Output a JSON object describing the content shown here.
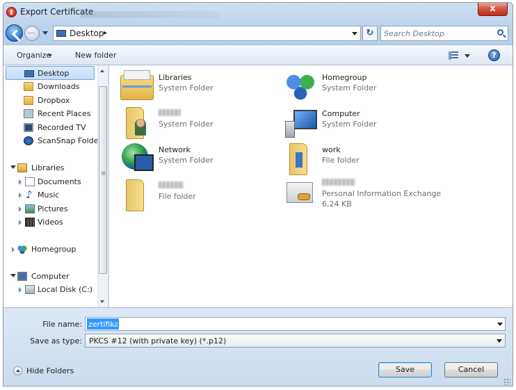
{
  "window": {
    "title": "Export Certificate",
    "close_label": "x"
  },
  "nav": {
    "address": {
      "location": "Desktop",
      "separator": "▸"
    },
    "refresh_label": "↻",
    "search": {
      "placeholder": "Search Desktop"
    }
  },
  "toolbar": {
    "organize_label": "Organize",
    "new_folder_label": "New folder",
    "help_label": "?"
  },
  "sidebar": {
    "favorites": [
      {
        "label": "Desktop",
        "icon": "desktop-icon",
        "selected": true
      },
      {
        "label": "Downloads",
        "icon": "folder-icon"
      },
      {
        "label": "Dropbox",
        "icon": "dropbox-icon"
      },
      {
        "label": "Recent Places",
        "icon": "recent-places-icon"
      },
      {
        "label": "Recorded TV",
        "icon": "tv-icon"
      },
      {
        "label": "ScanSnap Folder",
        "icon": "scansnap-icon"
      }
    ],
    "libraries": {
      "label": "Libraries",
      "items": [
        {
          "label": "Documents",
          "icon": "documents-icon"
        },
        {
          "label": "Music",
          "icon": "music-icon"
        },
        {
          "label": "Pictures",
          "icon": "pictures-icon"
        },
        {
          "label": "Videos",
          "icon": "videos-icon"
        }
      ]
    },
    "homegroup": {
      "label": "Homegroup"
    },
    "computer": {
      "label": "Computer",
      "items": [
        {
          "label": "Local Disk (C:)",
          "icon": "disk-icon"
        }
      ]
    }
  },
  "items": [
    {
      "name": "Libraries",
      "subtitle": "System Folder",
      "icon": "libraries-icon"
    },
    {
      "name": "Homegroup",
      "subtitle": "System Folder",
      "icon": "homegroup-icon"
    },
    {
      "name": "",
      "subtitle": "System Folder",
      "icon": "user-folder-icon",
      "name_redacted": true
    },
    {
      "name": "Computer",
      "subtitle": "System Folder",
      "icon": "computer-icon"
    },
    {
      "name": "Network",
      "subtitle": "System Folder",
      "icon": "network-icon"
    },
    {
      "name": "work",
      "subtitle": "File folder",
      "icon": "folder-icon"
    },
    {
      "name": "",
      "subtitle": "File folder",
      "icon": "folder-icon",
      "name_redacted": true
    },
    {
      "name": "",
      "subtitle": "Personal Information Exchange",
      "size": "6,24 KB",
      "icon": "certificate-icon",
      "name_redacted": true
    }
  ],
  "bottom": {
    "file_name_label": "File name:",
    "file_name_value": "zertifikat",
    "save_type_label": "Save as type:",
    "save_type_value": "PKCS #12 (with private key) (*.p12)",
    "hide_folders_label": "Hide Folders",
    "save_label": "Save",
    "cancel_label": "Cancel"
  }
}
